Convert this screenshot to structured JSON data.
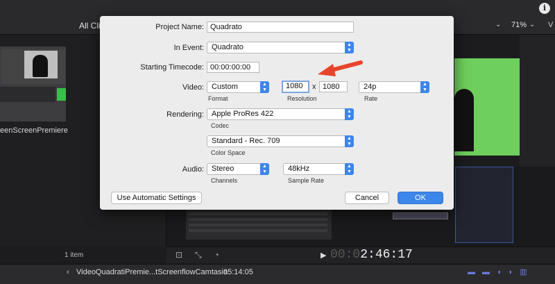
{
  "app": {
    "browser_header": "All Cli",
    "zoom_level": "71%",
    "clip_name": "eenScreenPremiere",
    "item_count": "1 item",
    "timecode_dim": "00:0",
    "timecode": "2:46:17",
    "project_title": "VideoQuadratiPremie...tScreenflowCamtasia",
    "project_duration": "05:14:05",
    "info_icon": "i",
    "view_label": "V"
  },
  "dialog": {
    "project_name_label": "Project Name:",
    "project_name_value": "Quadrato",
    "in_event_label": "In Event:",
    "in_event_value": "Quadrato",
    "starting_timecode_label": "Starting Timecode:",
    "starting_timecode_value": "00:00:00:00",
    "video_label": "Video:",
    "format_value": "Custom",
    "format_caption": "Format",
    "resolution_width": "1080",
    "resolution_x": "x",
    "resolution_height": "1080",
    "resolution_caption": "Resolution",
    "rate_value": "24p",
    "rate_caption": "Rate",
    "rendering_label": "Rendering:",
    "codec_value": "Apple ProRes 422",
    "codec_caption": "Codec",
    "color_space_value": "Standard - Rec. 709",
    "color_space_caption": "Color Space",
    "audio_label": "Audio:",
    "channels_value": "Stereo",
    "channels_caption": "Channels",
    "sample_rate_value": "48kHz",
    "sample_rate_caption": "Sample Rate",
    "use_automatic_settings_label": "Use Automatic Settings",
    "cancel_label": "Cancel",
    "ok_label": "OK"
  },
  "colors": {
    "accent": "#3d86ea",
    "annotation_arrow": "#e8442c",
    "green_screen": "#6ecf5c"
  }
}
